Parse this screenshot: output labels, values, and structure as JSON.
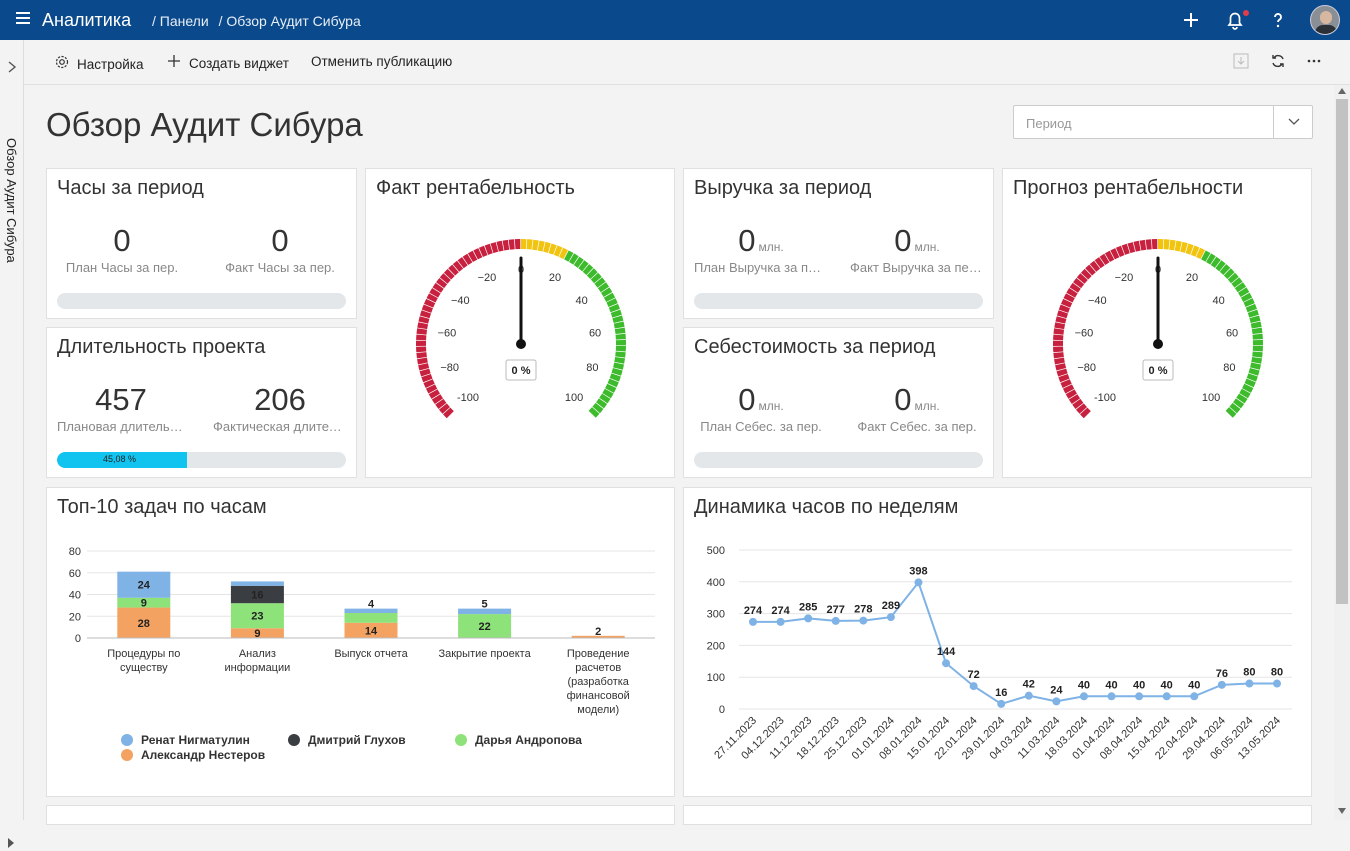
{
  "topbar": {
    "app_title": "Аналитика",
    "breadcrumb": [
      "/ Панели",
      "/ Обзор Аудит Сибура"
    ],
    "icons": [
      "plus-icon",
      "bell-icon",
      "help-icon"
    ]
  },
  "leftrail": {
    "vertical_title": "Обзор Аудит Сибура"
  },
  "toolbar": {
    "settings": "Настройка",
    "create_widget": "Создать виджет",
    "unpublish": "Отменить публикацию"
  },
  "page": {
    "title": "Обзор Аудит Сибура",
    "period_placeholder": "Период"
  },
  "hours": {
    "title": "Часы за период",
    "plan_value": "0",
    "plan_label": "План Часы за пер.",
    "fact_value": "0",
    "fact_label": "Факт Часы за пер."
  },
  "duration": {
    "title": "Длительность проекта",
    "plan_value": "457",
    "plan_label": "Плановая длительность",
    "fact_value": "206",
    "fact_label": "Фактическая длительность",
    "progress_label": "45,08 %",
    "progress": 0.4508
  },
  "revenue": {
    "title": "Выручка за период",
    "plan_value": "0",
    "plan_unit": "млн.",
    "plan_label": "План Выручка за период",
    "fact_value": "0",
    "fact_unit": "млн.",
    "fact_label": "Факт Выручка за период"
  },
  "cost": {
    "title": "Себестоимость за период",
    "plan_value": "0",
    "plan_unit": "млн.",
    "plan_label": "План Себес. за пер.",
    "fact_value": "0",
    "fact_unit": "млн.",
    "fact_label": "Факт Себес. за пер."
  },
  "gauge_fact": {
    "title": "Факт рентабельность",
    "value": 0,
    "value_label": "0 %",
    "min": -100,
    "max": 100,
    "ticks": [
      "-100",
      "−80",
      "−60",
      "−40",
      "−20",
      "0",
      "20",
      "40",
      "60",
      "80",
      "100"
    ]
  },
  "gauge_forecast": {
    "title": "Прогноз рентабельности",
    "value": 0,
    "value_label": "0 %",
    "min": -100,
    "max": 100,
    "ticks": [
      "-100",
      "−80",
      "−60",
      "−40",
      "−20",
      "0",
      "20",
      "40",
      "60",
      "80",
      "100"
    ]
  },
  "colors": {
    "accent": "#0a4a8c",
    "red": "#c8213f",
    "yellow": "#f1c40f",
    "green": "#3dbb2d",
    "blue": "#7fb2e5",
    "dark": "#3a3d41",
    "lightgreen": "#8ee27a",
    "orange": "#f4a261"
  },
  "chart_data": [
    {
      "type": "bar",
      "title": "Топ-10 задач по часам",
      "stacked": true,
      "categories": [
        "Процедуры по существу",
        "Анализ информации",
        "Выпуск отчета",
        "Закрытие проекта",
        "Проведение расчетов (разработка финансовой модели)"
      ],
      "category_lines": [
        [
          "Процедуры по",
          "существу"
        ],
        [
          "Анализ",
          "информации"
        ],
        [
          "Выпуск отчета"
        ],
        [
          "Закрытие проекта"
        ],
        [
          "Проведение",
          "расчетов",
          "(разработка",
          "финансовой",
          "модели)"
        ]
      ],
      "series": [
        {
          "name": "Александр Нестеров",
          "color": "#f4a261",
          "values": [
            28,
            9,
            14,
            0,
            2
          ]
        },
        {
          "name": "Дарья Андропова",
          "color": "#8ee27a",
          "values": [
            9,
            23,
            9,
            22,
            0
          ]
        },
        {
          "name": "Дмитрий Глухов",
          "color": "#3a3d41",
          "values": [
            0,
            16,
            0,
            0,
            0
          ]
        },
        {
          "name": "Ренат Нигматулин",
          "color": "#7fb2e5",
          "values": [
            24,
            4,
            4,
            5,
            0
          ]
        }
      ],
      "labels": [
        {
          "cat": 0,
          "series": 0,
          "text": "28"
        },
        {
          "cat": 0,
          "series": 1,
          "text": "9"
        },
        {
          "cat": 0,
          "series": 3,
          "text": "24"
        },
        {
          "cat": 1,
          "series": 0,
          "text": "9"
        },
        {
          "cat": 1,
          "series": 1,
          "text": "23"
        },
        {
          "cat": 1,
          "series": 2,
          "text": "16"
        },
        {
          "cat": 2,
          "series": 0,
          "text": "14"
        },
        {
          "cat": 2,
          "series": 3,
          "text": "4"
        },
        {
          "cat": 3,
          "series": 1,
          "text": "22"
        },
        {
          "cat": 3,
          "series": 3,
          "text": "5"
        },
        {
          "cat": 4,
          "series": 0,
          "text": "2"
        }
      ],
      "yticks": [
        "0",
        "20",
        "40",
        "60",
        "80"
      ],
      "ylim": [
        0,
        80
      ],
      "legend": [
        {
          "name": "Ренат Нигматулин",
          "color": "#7fb2e5"
        },
        {
          "name": "Дмитрий Глухов",
          "color": "#3a3d41"
        },
        {
          "name": "Дарья Андропова",
          "color": "#8ee27a"
        },
        {
          "name": "Александр Нестеров",
          "color": "#f4a261"
        }
      ],
      "legend_position": "bottom",
      "grid": true
    },
    {
      "type": "line",
      "title": "Динамика часов по неделям",
      "x": [
        "27.11.2023",
        "04.12.2023",
        "11.12.2023",
        "18.12.2023",
        "25.12.2023",
        "01.01.2024",
        "08.01.2024",
        "15.01.2024",
        "22.01.2024",
        "29.01.2024",
        "04.03.2024",
        "11.03.2024",
        "18.03.2024",
        "01.04.2024",
        "08.04.2024",
        "15.04.2024",
        "22.04.2024",
        "29.04.2024",
        "06.05.2024",
        "13.05.2024"
      ],
      "values": [
        274,
        274,
        285,
        277,
        278,
        289,
        398,
        144,
        72,
        16,
        42,
        24,
        40,
        40,
        40,
        40,
        40,
        76,
        80,
        80
      ],
      "value_labels": [
        "274",
        "274",
        "285",
        "277",
        "278",
        "289",
        "398",
        "144",
        "72",
        "16",
        "42",
        "24",
        "40",
        "40",
        "40",
        "40",
        "40",
        "76",
        "80",
        "80"
      ],
      "yticks": [
        "0",
        "100",
        "200",
        "300",
        "400",
        "500"
      ],
      "ylim": [
        0,
        500
      ],
      "grid": true,
      "color": "#7fb2e5"
    }
  ]
}
